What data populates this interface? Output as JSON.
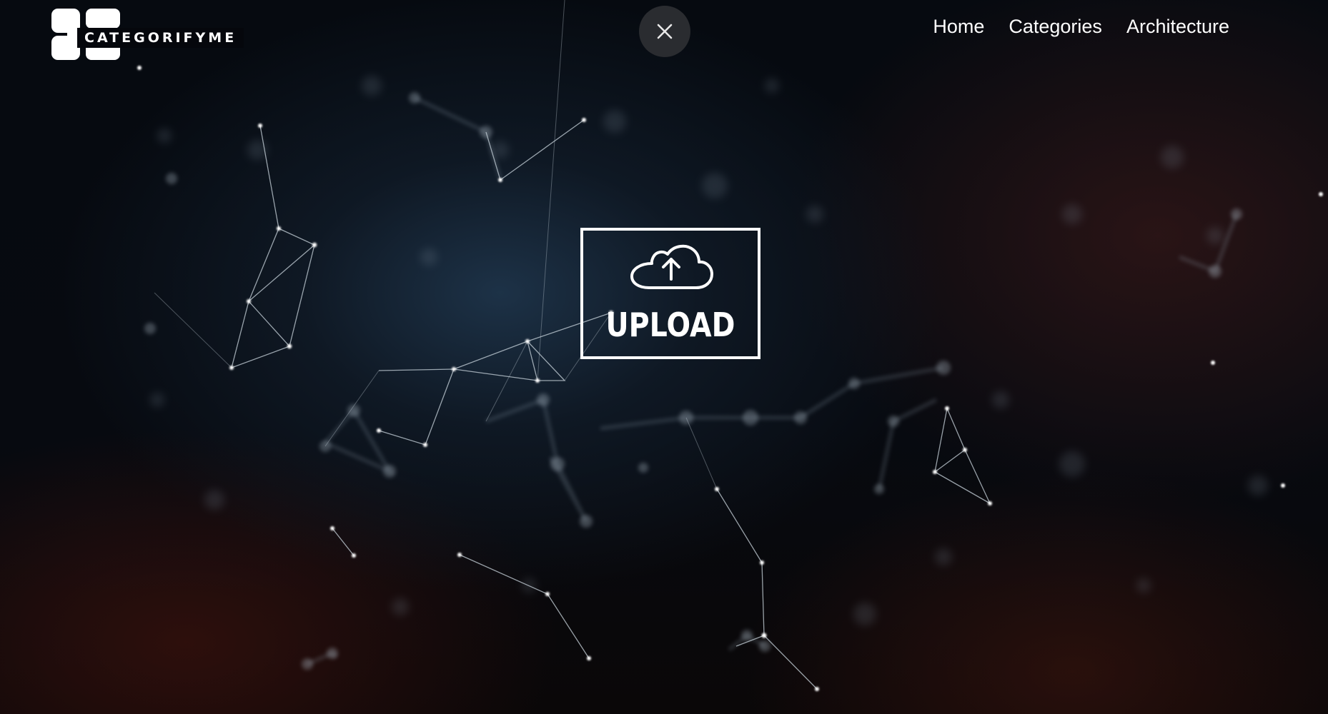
{
  "brand": {
    "name": "CATEGORIFYME"
  },
  "overlay": {
    "close_icon": "close-icon"
  },
  "nav": {
    "items": [
      {
        "label": "Home"
      },
      {
        "label": "Categories"
      },
      {
        "label": "Architecture"
      }
    ]
  },
  "upload": {
    "label": "UPLOAD",
    "icon": "cloud-upload-icon"
  },
  "colors": {
    "background": "#05070c",
    "foreground": "#ffffff",
    "close_button_bg": "#2a2c30"
  }
}
